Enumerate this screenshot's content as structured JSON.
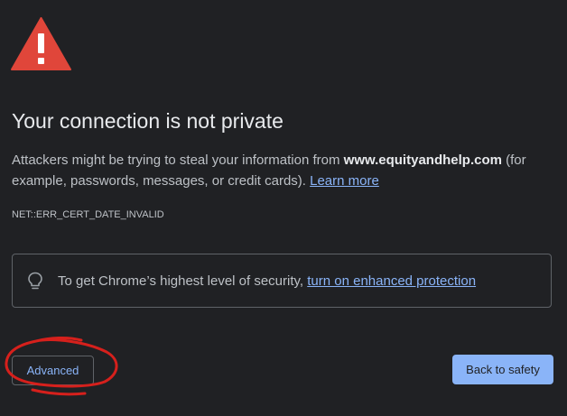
{
  "header": {
    "icon": "warning-triangle-icon",
    "title": "Your connection is not private"
  },
  "message": {
    "prefix": "Attackers might be trying to steal your information from ",
    "domain": "www.equityandhelp.com",
    "suffix": " (for example, passwords, messages, or credit cards). ",
    "learn_more": "Learn more"
  },
  "error_code": "NET::ERR_CERT_DATE_INVALID",
  "enhanced_protection": {
    "icon": "lightbulb-icon",
    "text": "To get Chrome’s highest level of security, ",
    "link": "turn on enhanced protection"
  },
  "buttons": {
    "advanced": "Advanced",
    "back_to_safety": "Back to safety"
  },
  "annotation": {
    "shape": "red-hand-drawn-circle",
    "color": "#d6201c"
  },
  "colors": {
    "background": "#202124",
    "warning_red": "#e0463a",
    "link_blue": "#8ab4f8",
    "primary_button": "#8ab4f8"
  }
}
